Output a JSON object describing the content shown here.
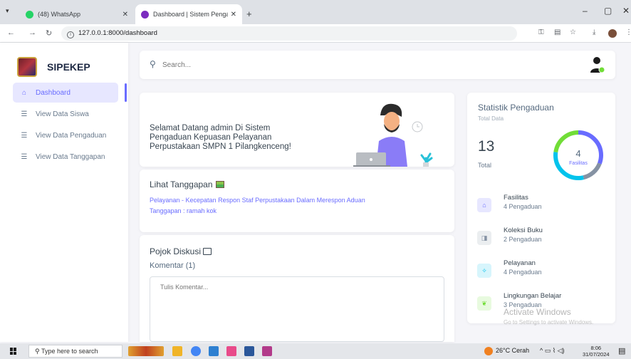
{
  "browser": {
    "tabs": [
      {
        "title": "(48) WhatsApp",
        "active": false,
        "favicon_color": "#25d366"
      },
      {
        "title": "Dashboard | Sistem Pengaduan",
        "active": true,
        "favicon_color": "#7b2cbf"
      }
    ],
    "url": "127.0.0.1:8000/dashboard"
  },
  "sidebar": {
    "brand": "SIPEKEP",
    "items": [
      {
        "label": "Dashboard",
        "icon": "home-icon",
        "active": true
      },
      {
        "label": "View Data Siswa",
        "icon": "table-icon",
        "active": false
      },
      {
        "label": "View Data Pengaduan",
        "icon": "table-icon",
        "active": false
      },
      {
        "label": "View Data Tanggapan",
        "icon": "table-icon",
        "active": false
      }
    ]
  },
  "search": {
    "placeholder": "Search..."
  },
  "welcome": {
    "line1": "Selamat Datang admin Di Sistem",
    "line2": "Pengaduan Kepuasan Pelayanan",
    "line3": "Perpustakaan SMPN 1 Pilangkenceng!"
  },
  "tanggapan": {
    "title": "Lihat Tanggapan",
    "line1": "Pelayanan - Kecepatan Respon Staf Perpustakaan Dalam Merespon Aduan",
    "line2": "Tanggapan : ramah kok"
  },
  "diskusi": {
    "title": "Pojok Diskusi",
    "komentar": "Komentar (1)",
    "placeholder": "Tulis Komentar..."
  },
  "statistik": {
    "title": "Statistik Pengaduan",
    "subtitle": "Total Data",
    "total_value": "13",
    "total_label": "Total",
    "donut_value": "4",
    "donut_label": "Fasilitas",
    "items": [
      {
        "name": "Fasilitas",
        "count": "4 Pengaduan",
        "icon": "home-icon",
        "color": "#696cff",
        "bg": "#e7e7ff"
      },
      {
        "name": "Koleksi Buku",
        "count": "2 Pengaduan",
        "icon": "book-icon",
        "color": "#8592a3",
        "bg": "#ebeef0"
      },
      {
        "name": "Pelayanan",
        "count": "4 Pengaduan",
        "icon": "service-icon",
        "color": "#03c3ec",
        "bg": "#d7f5fc"
      },
      {
        "name": "Lingkungan Belajar",
        "count": "3 Pengaduan",
        "icon": "leaf-icon",
        "color": "#71dd37",
        "bg": "#e8fadf"
      }
    ]
  },
  "watermark": {
    "line1": "Activate Windows",
    "line2": "Go to Settings to activate Windows."
  },
  "taskbar": {
    "search_placeholder": "Type here to search",
    "weather": "26°C  Cerah",
    "time": "8:06",
    "date": "31/07/2024"
  }
}
